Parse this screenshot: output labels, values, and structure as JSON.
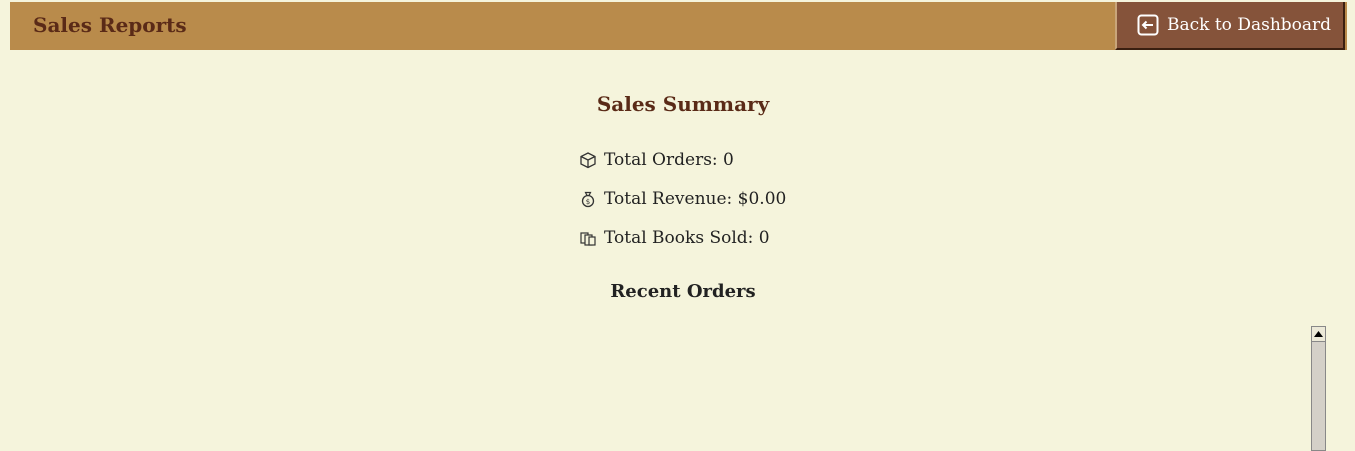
{
  "header": {
    "title": "Sales Reports",
    "back_label": "Back to Dashboard",
    "back_icon": "arrow-left-box-icon"
  },
  "summary": {
    "title": "Sales Summary",
    "stats": [
      {
        "icon": "box-icon",
        "label": "Total Orders: 0"
      },
      {
        "icon": "money-bag-icon",
        "label": "Total Revenue: $0.00"
      },
      {
        "icon": "books-icon",
        "label": "Total Books Sold: 0"
      }
    ]
  },
  "recent": {
    "title": "Recent Orders"
  },
  "colors": {
    "page_bg": "#f5f4dc",
    "header_bg": "#b98b4b",
    "button_bg": "#85533a",
    "title_color": "#5a2a17"
  }
}
